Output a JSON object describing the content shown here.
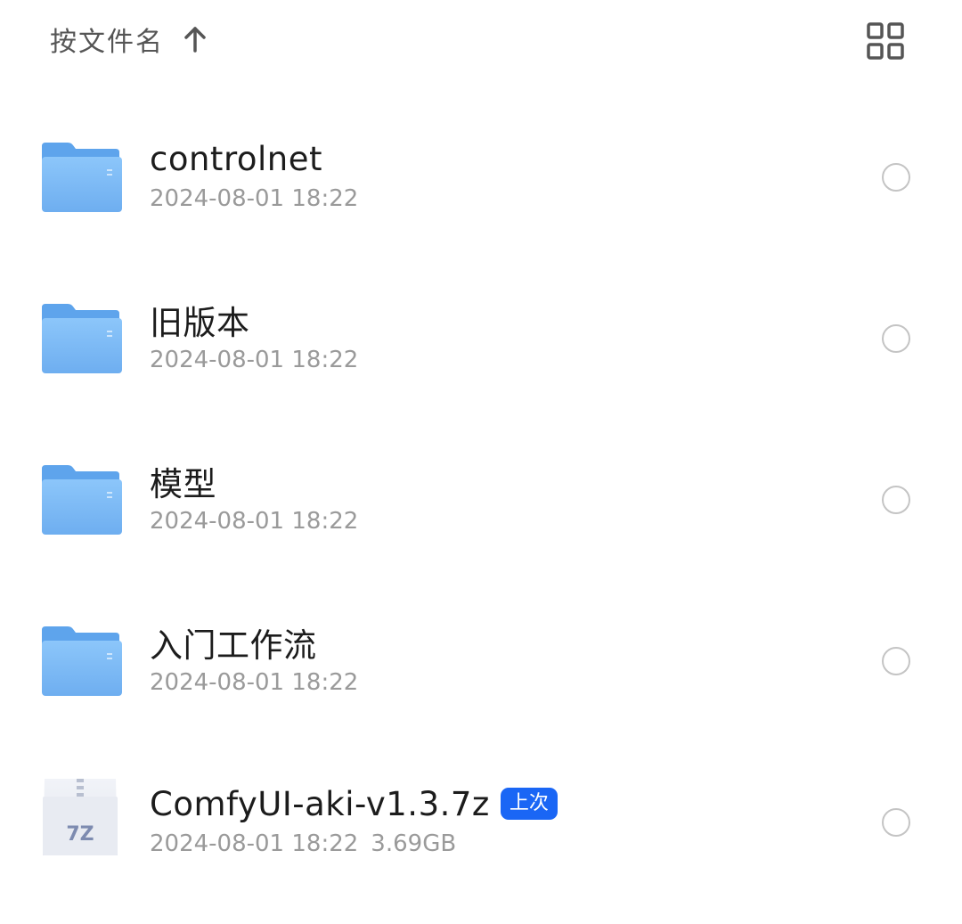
{
  "header": {
    "sort_label": "按文件名",
    "sort_direction_icon": "arrow-up-icon",
    "view_toggle_icon": "grid-view-icon"
  },
  "files": [
    {
      "name": "controlnet",
      "modified": "2024-08-01 18:22",
      "type": "folder",
      "icon": "folder-icon"
    },
    {
      "name": "旧版本",
      "modified": "2024-08-01 18:22",
      "type": "folder",
      "icon": "folder-icon"
    },
    {
      "name": "模型",
      "modified": "2024-08-01 18:22",
      "type": "folder",
      "icon": "folder-icon"
    },
    {
      "name": "入门工作流",
      "modified": "2024-08-01 18:22",
      "type": "folder",
      "icon": "folder-icon"
    },
    {
      "name": "ComfyUI-aki-v1.3.7z",
      "modified": "2024-08-01 18:22",
      "size": "3.69GB",
      "badge": "上次",
      "type": "archive",
      "icon": "7z-archive-icon",
      "icon_text": "7Z"
    }
  ],
  "colors": {
    "accent": "#1a66f5",
    "folder": "#7fbbf5",
    "text_primary": "#1c1c1c",
    "text_secondary": "#9a9a9a"
  }
}
